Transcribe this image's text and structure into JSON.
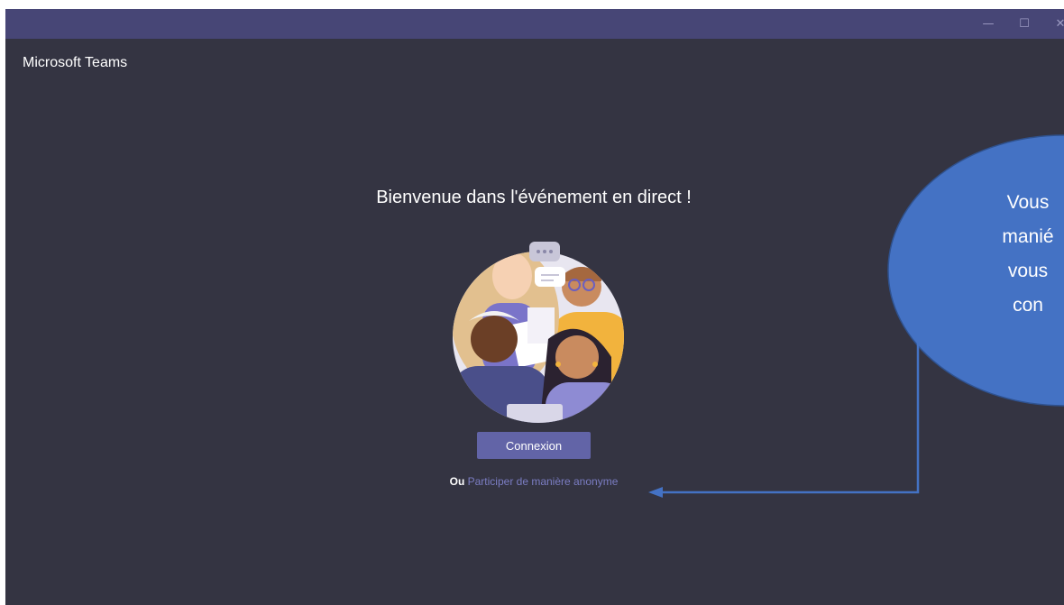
{
  "window": {
    "controls": {
      "minimize": "—",
      "maximize": "☐",
      "close": "✕"
    }
  },
  "app": {
    "title": "Microsoft Teams"
  },
  "main": {
    "welcome": "Bienvenue dans l'événement en direct !",
    "connect_label": "Connexion",
    "or_label": "Ou",
    "anonymous_link": "Participer de manière anonyme"
  },
  "callout": {
    "lines": [
      "Vous",
      "manié",
      "vous",
      "con"
    ]
  },
  "colors": {
    "background": "#343442",
    "titlebar": "#474676",
    "button": "#6264a7",
    "link": "#7b7dc3",
    "callout_fill": "#4472c4",
    "callout_stroke": "#2f528f"
  }
}
